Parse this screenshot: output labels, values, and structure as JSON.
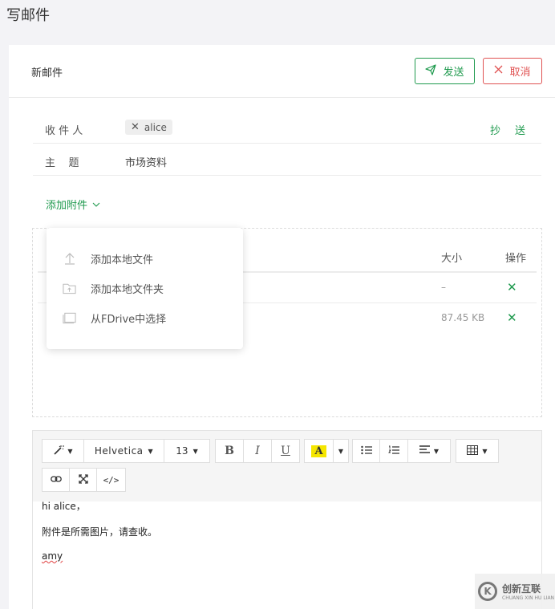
{
  "page": {
    "title": "写邮件"
  },
  "header": {
    "title": "新邮件",
    "send_label": "发送",
    "cancel_label": "取消"
  },
  "recipient": {
    "label": "收 件 人",
    "tag": "alice",
    "cc_label": "抄",
    "bcc_label": "送"
  },
  "subject": {
    "label": "主    题",
    "value": "市场资料"
  },
  "attachment": {
    "add_label": "添加附件",
    "columns": {
      "size": "大小",
      "action": "操作"
    },
    "rows": [
      {
        "size": "–"
      },
      {
        "size": "87.45 KB"
      }
    ],
    "menu": [
      {
        "label": "添加本地文件",
        "icon": "upload-icon"
      },
      {
        "label": "添加本地文件夹",
        "icon": "folder-upload-icon"
      },
      {
        "label": "从FDrive中选择",
        "icon": "drive-icon"
      }
    ]
  },
  "toolbar": {
    "font": "Helvetica",
    "size": "13",
    "bold": "B",
    "italic": "I",
    "underline": "U",
    "highlight": "A",
    "code": "</>"
  },
  "body": {
    "line1": "hi alice，",
    "line2": "附件是所需图片，请查收。",
    "line3": "amy"
  },
  "watermark": {
    "cn": "创新互联",
    "en": "CHUANG XIN HU LIAN",
    "mark": "K"
  },
  "colors": {
    "accent": "#1f9a4e",
    "danger": "#e05252",
    "highlight": "#f5e600"
  }
}
